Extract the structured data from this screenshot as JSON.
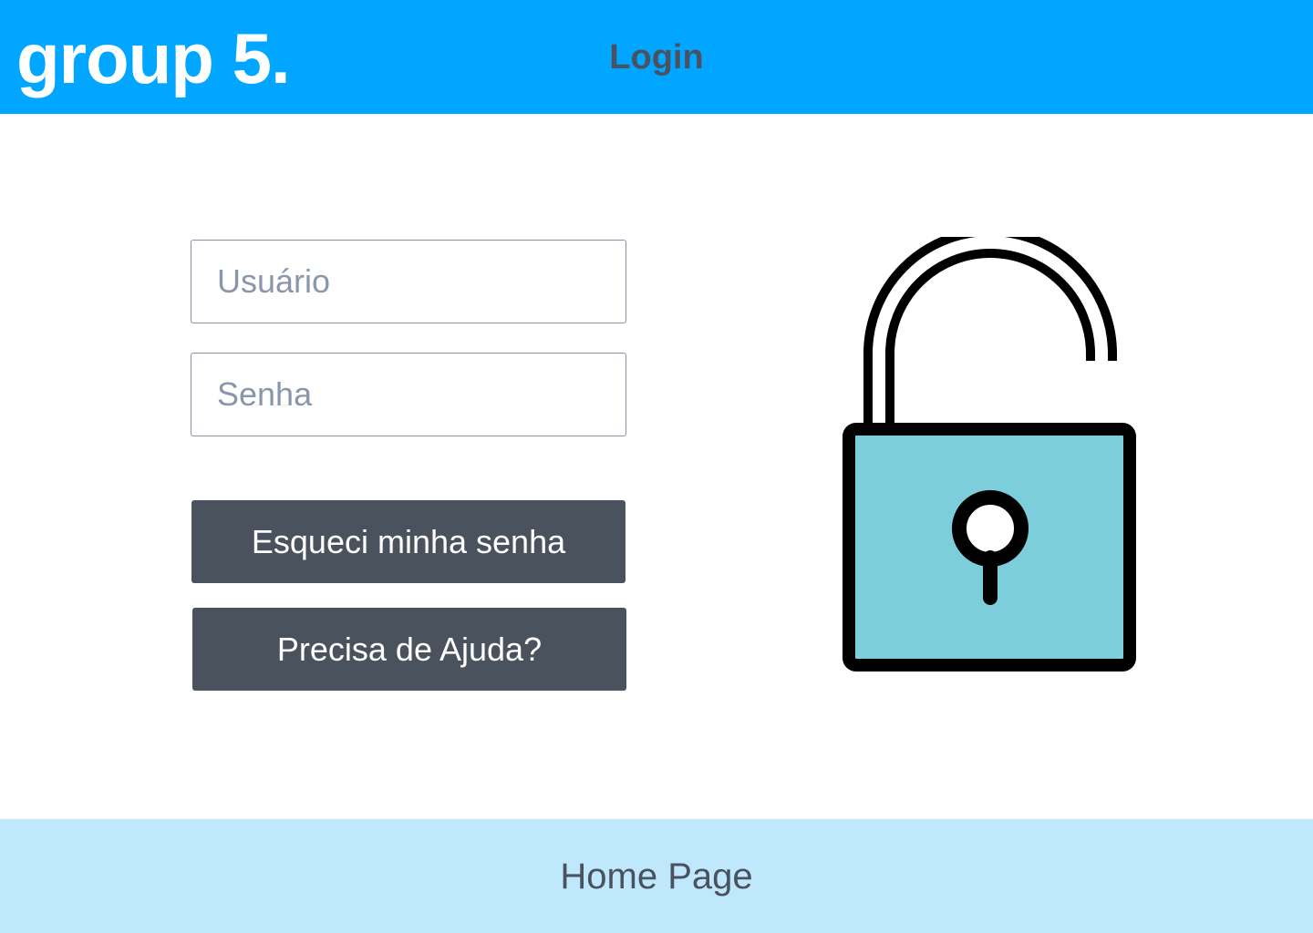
{
  "header": {
    "brand": "group 5.",
    "title": "Login",
    "background_color": "#00a6ff"
  },
  "form": {
    "username_placeholder": "Usuário",
    "username_value": "",
    "password_placeholder": "Senha",
    "password_value": "",
    "forgot_password_label": "Esqueci minha senha",
    "help_label": "Precisa de Ajuda?",
    "button_color": "#4a525e"
  },
  "illustration": {
    "icon": "unlocked-padlock-icon",
    "body_color": "#7ccfda",
    "outline_color": "#000000"
  },
  "footer": {
    "link_label": "Home Page",
    "background_color": "#bfe8fd"
  }
}
